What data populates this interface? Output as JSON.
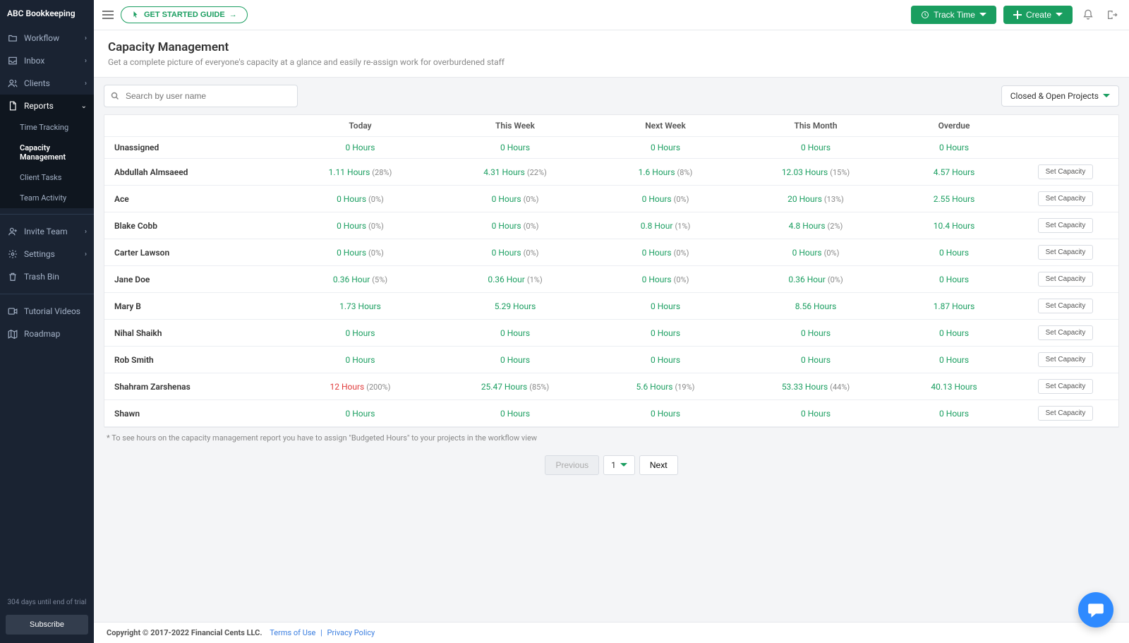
{
  "brand": "ABC Bookkeeping",
  "topbar": {
    "getStarted": "GET STARTED GUIDE",
    "trackTime": "Track Time",
    "create": "Create"
  },
  "sidebar": {
    "items": [
      {
        "label": "Workflow",
        "icon": "folder"
      },
      {
        "label": "Inbox",
        "icon": "inbox"
      },
      {
        "label": "Clients",
        "icon": "users"
      },
      {
        "label": "Reports",
        "icon": "doc",
        "active": true
      }
    ],
    "subItems": [
      {
        "label": "Time Tracking"
      },
      {
        "label": "Capacity Management",
        "active": true
      },
      {
        "label": "Client Tasks"
      },
      {
        "label": "Team Activity"
      }
    ],
    "lower": [
      {
        "label": "Invite Team",
        "icon": "user-plus",
        "expandable": true
      },
      {
        "label": "Settings",
        "icon": "gear",
        "expandable": true
      },
      {
        "label": "Trash Bin",
        "icon": "trash"
      }
    ],
    "footer": [
      {
        "label": "Tutorial Videos",
        "icon": "video"
      },
      {
        "label": "Roadmap",
        "icon": "map"
      }
    ],
    "trial": "304 days until end of trial",
    "subscribe": "Subscribe"
  },
  "page": {
    "title": "Capacity Management",
    "desc": "Get a complete picture of everyone's capacity at a glance and easily re-assign work for overburdened staff"
  },
  "search": {
    "placeholder": "Search by user name"
  },
  "filter": "Closed & Open Projects",
  "columns": [
    "",
    "Today",
    "This Week",
    "Next Week",
    "This Month",
    "Overdue",
    ""
  ],
  "actionLabel": "Set Capacity",
  "rows": [
    {
      "name": "Unassigned",
      "cells": [
        {
          "h": "0 Hours"
        },
        {
          "h": "0 Hours"
        },
        {
          "h": "0 Hours"
        },
        {
          "h": "0 Hours"
        },
        {
          "h": "0 Hours"
        }
      ],
      "noAction": true
    },
    {
      "name": "Abdullah Almsaeed",
      "cells": [
        {
          "h": "1.11 Hours",
          "p": "(28%)"
        },
        {
          "h": "4.31 Hours",
          "p": "(22%)"
        },
        {
          "h": "1.6 Hours",
          "p": "(8%)"
        },
        {
          "h": "12.03 Hours",
          "p": "(15%)"
        },
        {
          "h": "4.57 Hours"
        }
      ]
    },
    {
      "name": "Ace",
      "cells": [
        {
          "h": "0 Hours",
          "p": "(0%)"
        },
        {
          "h": "0 Hours",
          "p": "(0%)"
        },
        {
          "h": "0 Hours",
          "p": "(0%)"
        },
        {
          "h": "20 Hours",
          "p": "(13%)"
        },
        {
          "h": "2.55 Hours"
        }
      ]
    },
    {
      "name": "Blake Cobb",
      "cells": [
        {
          "h": "0 Hours",
          "p": "(0%)"
        },
        {
          "h": "0 Hours",
          "p": "(0%)"
        },
        {
          "h": "0.8 Hour",
          "p": "(1%)"
        },
        {
          "h": "4.8 Hours",
          "p": "(2%)"
        },
        {
          "h": "10.4 Hours"
        }
      ]
    },
    {
      "name": "Carter Lawson",
      "cells": [
        {
          "h": "0 Hours",
          "p": "(0%)"
        },
        {
          "h": "0 Hours",
          "p": "(0%)"
        },
        {
          "h": "0 Hours",
          "p": "(0%)"
        },
        {
          "h": "0 Hours",
          "p": "(0%)"
        },
        {
          "h": "0 Hours"
        }
      ]
    },
    {
      "name": "Jane Doe",
      "cells": [
        {
          "h": "0.36 Hour",
          "p": "(5%)"
        },
        {
          "h": "0.36 Hour",
          "p": "(1%)"
        },
        {
          "h": "0 Hours",
          "p": "(0%)"
        },
        {
          "h": "0.36 Hour",
          "p": "(0%)"
        },
        {
          "h": "0 Hours"
        }
      ]
    },
    {
      "name": "Mary B",
      "cells": [
        {
          "h": "1.73 Hours"
        },
        {
          "h": "5.29 Hours"
        },
        {
          "h": "0 Hours"
        },
        {
          "h": "8.56 Hours"
        },
        {
          "h": "1.87 Hours"
        }
      ]
    },
    {
      "name": "Nihal Shaikh",
      "cells": [
        {
          "h": "0 Hours"
        },
        {
          "h": "0 Hours"
        },
        {
          "h": "0 Hours"
        },
        {
          "h": "0 Hours"
        },
        {
          "h": "0 Hours"
        }
      ]
    },
    {
      "name": "Rob Smith",
      "cells": [
        {
          "h": "0 Hours"
        },
        {
          "h": "0 Hours"
        },
        {
          "h": "0 Hours"
        },
        {
          "h": "0 Hours"
        },
        {
          "h": "0 Hours"
        }
      ]
    },
    {
      "name": "Shahram Zarshenas",
      "cells": [
        {
          "h": "12 Hours",
          "p": "(200%)",
          "over": true
        },
        {
          "h": "25.47 Hours",
          "p": "(85%)"
        },
        {
          "h": "5.6 Hours",
          "p": "(19%)"
        },
        {
          "h": "53.33 Hours",
          "p": "(44%)"
        },
        {
          "h": "40.13 Hours"
        }
      ]
    },
    {
      "name": "Shawn",
      "cells": [
        {
          "h": "0 Hours"
        },
        {
          "h": "0 Hours"
        },
        {
          "h": "0 Hours"
        },
        {
          "h": "0 Hours"
        },
        {
          "h": "0 Hours"
        }
      ]
    }
  ],
  "note": "* To see hours on the capacity management report you have to assign \"Budgeted Hours\" to your projects in the workflow view",
  "pagination": {
    "prev": "Previous",
    "next": "Next",
    "page": "1"
  },
  "footer": {
    "copyright": "Copyright © 2017-2022 Financial Cents LLC.",
    "terms": "Terms of Use",
    "privacy": "Privacy Policy"
  }
}
